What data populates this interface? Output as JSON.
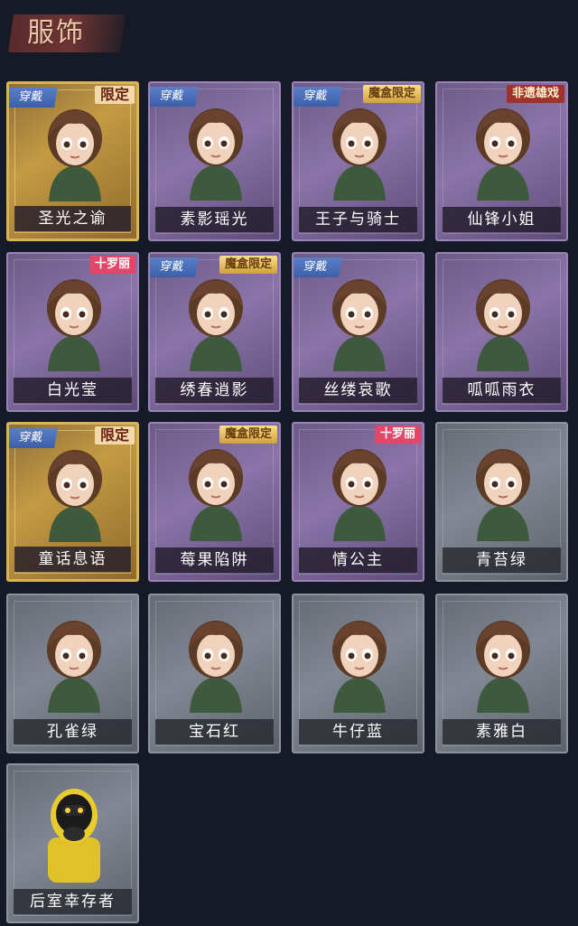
{
  "page": {
    "title": "服饰"
  },
  "costumes": [
    {
      "name": "圣光之谕",
      "tier": "gold",
      "worn": "穿戴",
      "badge": "限定",
      "badge_type": "limited",
      "icon": "character-portrait-icon"
    },
    {
      "name": "素影瑶光",
      "tier": "purple",
      "worn": "穿戴",
      "badge": "",
      "badge_type": "",
      "icon": "character-portrait-icon"
    },
    {
      "name": "王子与骑士",
      "tier": "purple",
      "worn": "穿戴",
      "badge": "魔盒限定",
      "badge_type": "magic",
      "icon": "character-portrait-icon"
    },
    {
      "name": "仙锋小姐",
      "tier": "purple",
      "worn": "",
      "badge": "非遗雄戏",
      "badge_type": "heritage",
      "icon": "character-portrait-icon"
    },
    {
      "name": "白光莹",
      "tier": "purple",
      "worn": "",
      "badge": "十罗丽",
      "badge_type": "lolita",
      "icon": "character-portrait-icon"
    },
    {
      "name": "绣春逍影",
      "tier": "purple",
      "worn": "穿戴",
      "badge": "魔盒限定",
      "badge_type": "magic",
      "icon": "character-portrait-icon"
    },
    {
      "name": "丝缕哀歌",
      "tier": "purple",
      "worn": "穿戴",
      "badge": "",
      "badge_type": "",
      "icon": "character-portrait-icon"
    },
    {
      "name": "呱呱雨衣",
      "tier": "purple",
      "worn": "",
      "badge": "",
      "badge_type": "",
      "icon": "character-portrait-icon"
    },
    {
      "name": "童话息语",
      "tier": "gold",
      "worn": "穿戴",
      "badge": "限定",
      "badge_type": "limited",
      "icon": "character-portrait-icon"
    },
    {
      "name": "莓果陷阱",
      "tier": "purple",
      "worn": "",
      "badge": "魔盒限定",
      "badge_type": "magic",
      "icon": "character-portrait-icon"
    },
    {
      "name": "情公主",
      "tier": "purple",
      "worn": "",
      "badge": "十罗丽",
      "badge_type": "lolita",
      "icon": "character-portrait-icon"
    },
    {
      "name": "青苔绿",
      "tier": "gray",
      "worn": "",
      "badge": "",
      "badge_type": "",
      "icon": "character-portrait-icon"
    },
    {
      "name": "孔雀绿",
      "tier": "gray",
      "worn": "",
      "badge": "",
      "badge_type": "",
      "icon": "character-portrait-icon"
    },
    {
      "name": "宝石红",
      "tier": "gray",
      "worn": "",
      "badge": "",
      "badge_type": "",
      "icon": "character-portrait-icon"
    },
    {
      "name": "牛仔蓝",
      "tier": "gray",
      "worn": "",
      "badge": "",
      "badge_type": "",
      "icon": "character-portrait-icon"
    },
    {
      "name": "素雅白",
      "tier": "gray",
      "worn": "",
      "badge": "",
      "badge_type": "",
      "icon": "character-portrait-icon"
    },
    {
      "name": "后室幸存者",
      "tier": "gray",
      "worn": "",
      "badge": "",
      "badge_type": "",
      "icon": "hazmat-character-portrait-icon"
    }
  ],
  "colors": {
    "background": "#151a26",
    "gold": "#c49a44",
    "purple": "#8a74a8",
    "gray": "#818893",
    "worn_ribbon": "#4a6fbb"
  }
}
